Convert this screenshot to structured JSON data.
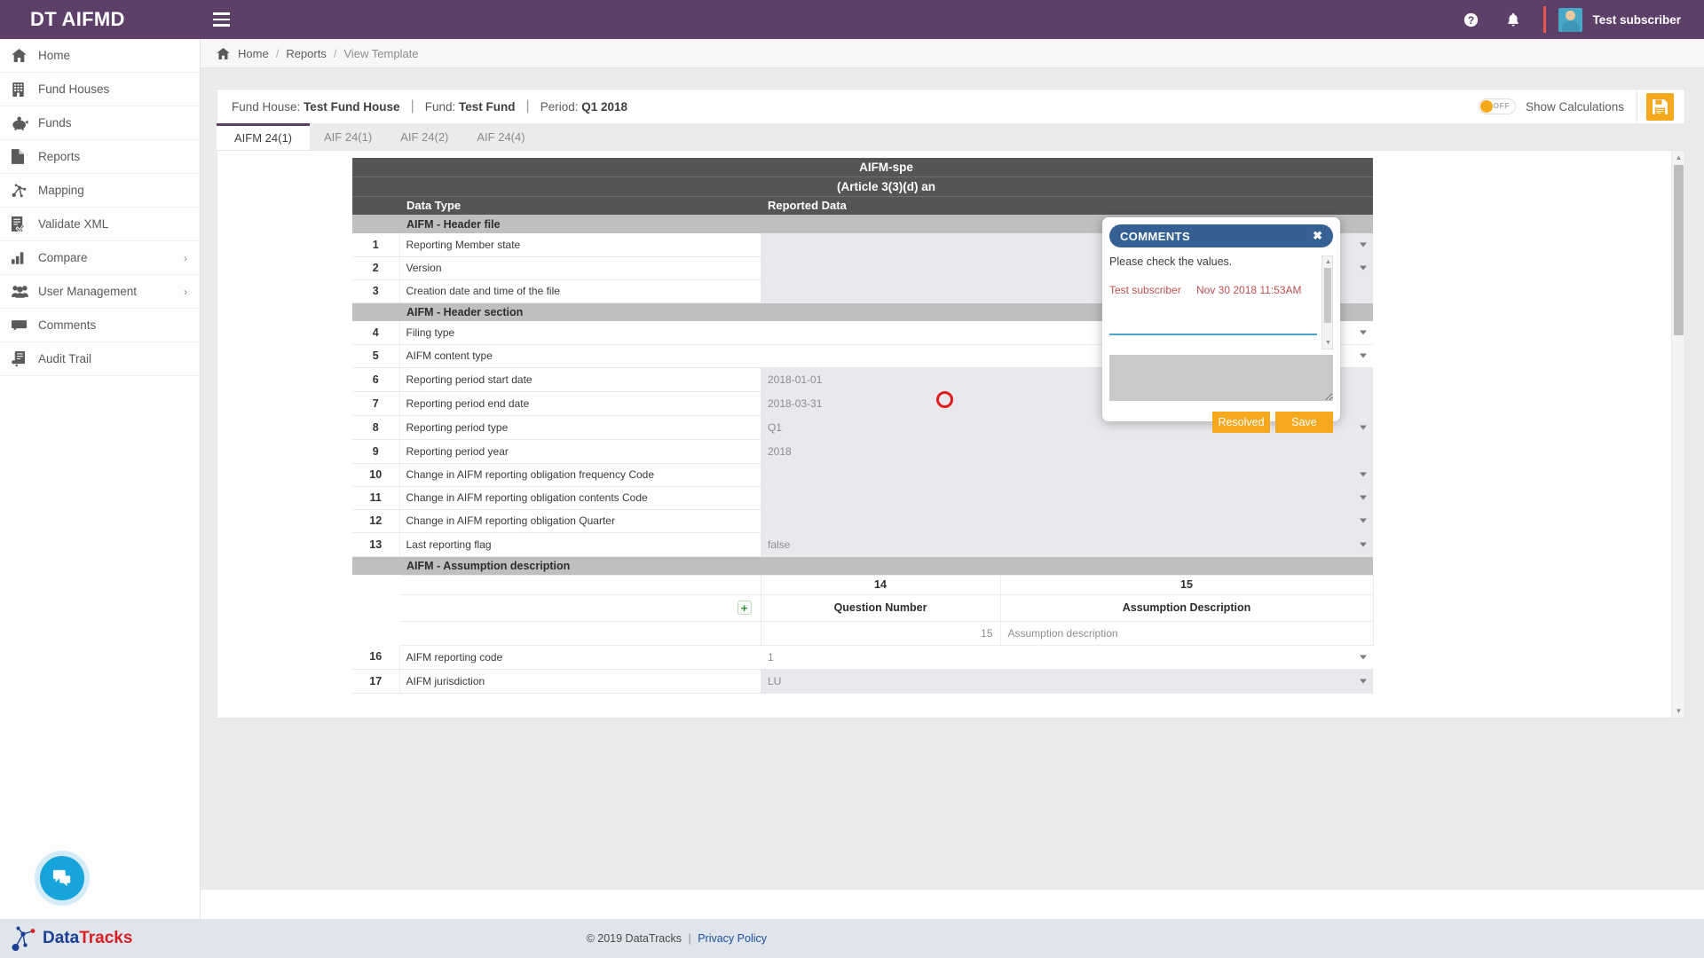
{
  "app": {
    "brand": "DT AIFMD",
    "username": "Test subscriber"
  },
  "breadcrumb": {
    "home": "Home",
    "sep": "/",
    "reports": "Reports",
    "current": "View Template"
  },
  "sidebar": {
    "items": [
      {
        "label": "Home",
        "icon": "home-icon",
        "caret": ""
      },
      {
        "label": "Fund Houses",
        "icon": "building-icon",
        "caret": ""
      },
      {
        "label": "Funds",
        "icon": "piggy-bank-icon",
        "caret": ""
      },
      {
        "label": "Reports",
        "icon": "document-icon",
        "caret": ""
      },
      {
        "label": "Mapping",
        "icon": "mapping-nodes-icon",
        "caret": ""
      },
      {
        "label": "Validate XML",
        "icon": "validate-xml-icon",
        "caret": ""
      },
      {
        "label": "Compare",
        "icon": "bar-chart-icon",
        "caret": "›"
      },
      {
        "label": "User Management",
        "icon": "users-icon",
        "caret": "›"
      },
      {
        "label": "Comments",
        "icon": "comment-icon",
        "caret": ""
      },
      {
        "label": "Audit Trail",
        "icon": "audit-trail-icon",
        "caret": ""
      }
    ]
  },
  "infobar": {
    "fund_house_label": "Fund House:",
    "fund_house_value": "Test Fund House",
    "fund_label": "Fund:",
    "fund_value": "Test Fund",
    "period_label": "Period:",
    "period_value": "Q1 2018",
    "toggle_state": "OFF",
    "calc_label": "Show Calculations",
    "save_icon": "floppy-disk-save-icon"
  },
  "tabs": [
    {
      "label": "AIFM 24(1)",
      "active": true
    },
    {
      "label": "AIF 24(1)",
      "active": false
    },
    {
      "label": "AIF 24(2)",
      "active": false
    },
    {
      "label": "AIF 24(4)",
      "active": false
    }
  ],
  "table": {
    "header_line1": "AIFM-spe",
    "header_line2": "(Article 3(3)(d) an",
    "header_line2_end": ")",
    "col_data_type": "Data Type",
    "col_reported_data": "Reported Data",
    "sections": {
      "header_file": "AIFM - Header file",
      "header_section": "AIFM - Header section",
      "assumption": "AIFM - Assumption description"
    },
    "rows": [
      {
        "num": "1",
        "desc": "Reporting Member state",
        "value": "",
        "caret": true,
        "shaded": true
      },
      {
        "num": "2",
        "desc": "Version",
        "value": "",
        "caret": true,
        "shaded": true
      },
      {
        "num": "3",
        "desc": "Creation date and time of the file",
        "value": "",
        "caret": false,
        "shaded": true
      },
      {
        "num": "4",
        "desc": "Filing type",
        "value": "",
        "caret": true,
        "shaded": false
      },
      {
        "num": "5",
        "desc": "AIFM content type",
        "value": "",
        "caret": true,
        "shaded": false
      },
      {
        "num": "6",
        "desc": "Reporting period start date",
        "value": "2018-01-01",
        "caret": false,
        "shaded": true
      },
      {
        "num": "7",
        "desc": "Reporting period end date",
        "value": "2018-03-31",
        "caret": false,
        "shaded": true
      },
      {
        "num": "8",
        "desc": "Reporting period type",
        "value": "Q1",
        "caret": true,
        "shaded": true
      },
      {
        "num": "9",
        "desc": "Reporting period year",
        "value": "2018",
        "caret": false,
        "shaded": true
      },
      {
        "num": "10",
        "desc": "Change in AIFM reporting obligation frequency Code",
        "value": "",
        "caret": true,
        "shaded": true
      },
      {
        "num": "11",
        "desc": "Change in AIFM reporting obligation contents Code",
        "value": "",
        "caret": true,
        "shaded": true
      },
      {
        "num": "12",
        "desc": "Change in AIFM reporting obligation Quarter",
        "value": "",
        "caret": true,
        "shaded": true
      },
      {
        "num": "13",
        "desc": "Last reporting flag",
        "value": "false",
        "caret": true,
        "shaded": true
      }
    ],
    "assumption": {
      "col_num_14": "14",
      "col_num_15": "15",
      "col_label_14": "Question Number",
      "col_label_15": "Assumption Description",
      "value_14": "15",
      "value_15": "Assumption description",
      "add_button": "+"
    },
    "rows_tail": [
      {
        "num": "16",
        "desc": "AIFM reporting code",
        "value": "1",
        "caret": true,
        "shaded": false
      },
      {
        "num": "17",
        "desc": "AIFM jurisdiction",
        "value": "LU",
        "caret": true,
        "shaded": true
      }
    ]
  },
  "comments_popup": {
    "title": "COMMENTS",
    "close": "✖",
    "body_text": "Please check the values.",
    "author": "Test subscriber",
    "timestamp": "Nov 30 2018 11:53AM",
    "new_comment_value": "",
    "resolved_label": "Resolved",
    "save_label": "Save"
  },
  "footer": {
    "logo_part1": "Data",
    "logo_part2": "Tracks",
    "copyright": "© 2019 DataTracks",
    "pipe": "|",
    "privacy": "Privacy Policy"
  },
  "colors": {
    "brand_purple": "#5d4068",
    "accent_orange": "#f5a81c",
    "popup_blue": "#356094",
    "marker_red": "#e01b1b",
    "chat_blue": "#17a3db"
  }
}
